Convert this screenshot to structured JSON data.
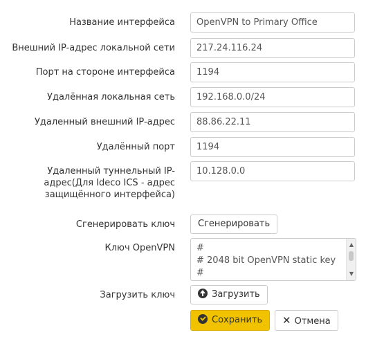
{
  "form": {
    "interface_name": {
      "label": "Название интерфейса",
      "value": "OpenVPN to Primary Office"
    },
    "local_external_ip": {
      "label": "Внешний IP-адрес локальной сети",
      "value": "217.24.116.24"
    },
    "interface_port": {
      "label": "Порт на стороне интерфейса",
      "value": "1194"
    },
    "remote_local_network": {
      "label": "Удалённая локальная сеть",
      "value": "192.168.0.0/24"
    },
    "remote_external_ip": {
      "label": "Удаленный внешний IP-адрес",
      "value": "88.86.22.11"
    },
    "remote_port": {
      "label": "Удалённый порт",
      "value": "1194"
    },
    "remote_tunnel_ip": {
      "label_lines": [
        "Удаленный туннельный IP-",
        "адрес(Для Ideco ICS - адрес",
        "защищённого интерфейса)"
      ],
      "value": "10.128.0.0"
    },
    "generate_key": {
      "label": "Сгенерировать ключ",
      "button": "Сгенерировать"
    },
    "openvpn_key": {
      "label": "Ключ OpenVPN",
      "lines": [
        "#",
        "# 2048 bit OpenVPN static key",
        "#"
      ]
    },
    "upload_key": {
      "label": "Загрузить ключ",
      "button": "Загрузить"
    }
  },
  "actions": {
    "save": "Сохранить",
    "cancel": "Отмена"
  },
  "icons": {
    "upload": "upload-circle-icon",
    "save": "check-circle-icon",
    "cancel": "close-icon"
  },
  "colors": {
    "primary_button": "#f0c200",
    "border": "#cccccc",
    "text": "#333333"
  }
}
